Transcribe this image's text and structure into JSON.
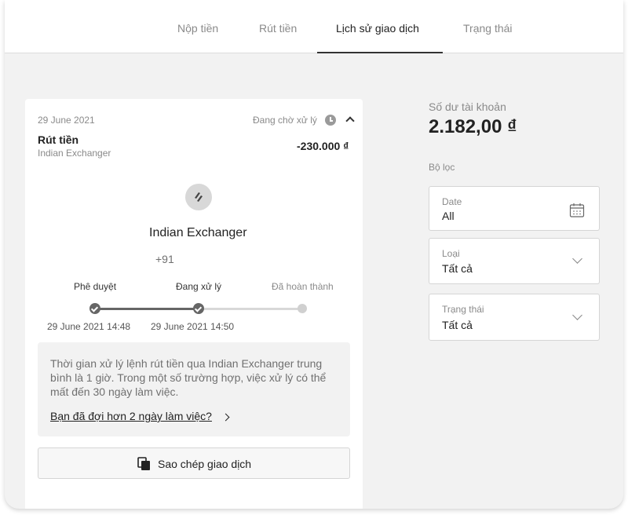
{
  "tabs": [
    {
      "label": "Nộp tiền",
      "active": false
    },
    {
      "label": "Rút tiền",
      "active": false
    },
    {
      "label": "Lịch sử giao dịch",
      "active": true
    },
    {
      "label": "Trạng thái",
      "active": false
    }
  ],
  "transaction": {
    "date": "29 June 2021",
    "status": "Đang chờ xử lý",
    "type": "Rút tiền",
    "method": "Indian Exchanger",
    "amount": "-230.000 ₫",
    "provider_name": "Indian Exchanger",
    "phone_prefix": "+91",
    "steps": [
      {
        "label": "Phê duyệt",
        "time": "29 June 2021 14:48",
        "state": "done"
      },
      {
        "label": "Đang xử lý",
        "time": "29 June 2021 14:50",
        "state": "done"
      },
      {
        "label": "Đã hoàn thành",
        "time": "",
        "state": "pending"
      }
    ],
    "info_text": "Thời gian xử lý lệnh rút tiền qua Indian Exchanger trung bình là 1 giờ. Trong một số trường hợp, việc xử lý có thể mất đến 30 ngày làm việc.",
    "info_link": "Bạn đã đợi hơn 2 ngày làm việc?",
    "copy_button": "Sao chép giao dịch"
  },
  "balance": {
    "label": "Số dư tài khoản",
    "amount": "2.182,00 ₫"
  },
  "filters": {
    "heading": "Bộ lọc",
    "date": {
      "label": "Date",
      "value": "All"
    },
    "type": {
      "label": "Loại",
      "value": "Tất cả"
    },
    "status": {
      "label": "Trạng thái",
      "value": "Tất cả"
    }
  },
  "icons": {
    "status": "clock-icon",
    "collapse": "chevron-up-icon",
    "provider_logo": "indian-exchanger-logo-icon",
    "copy": "copy-icon",
    "calendar": "calendar-icon",
    "dropdown": "chevron-down-icon"
  },
  "colors": {
    "background": "#f2f2f2",
    "card": "#ffffff",
    "text": "#222222",
    "muted": "#8a8a8a",
    "progress_done": "#666666",
    "progress_pending": "#d0d0d0"
  }
}
